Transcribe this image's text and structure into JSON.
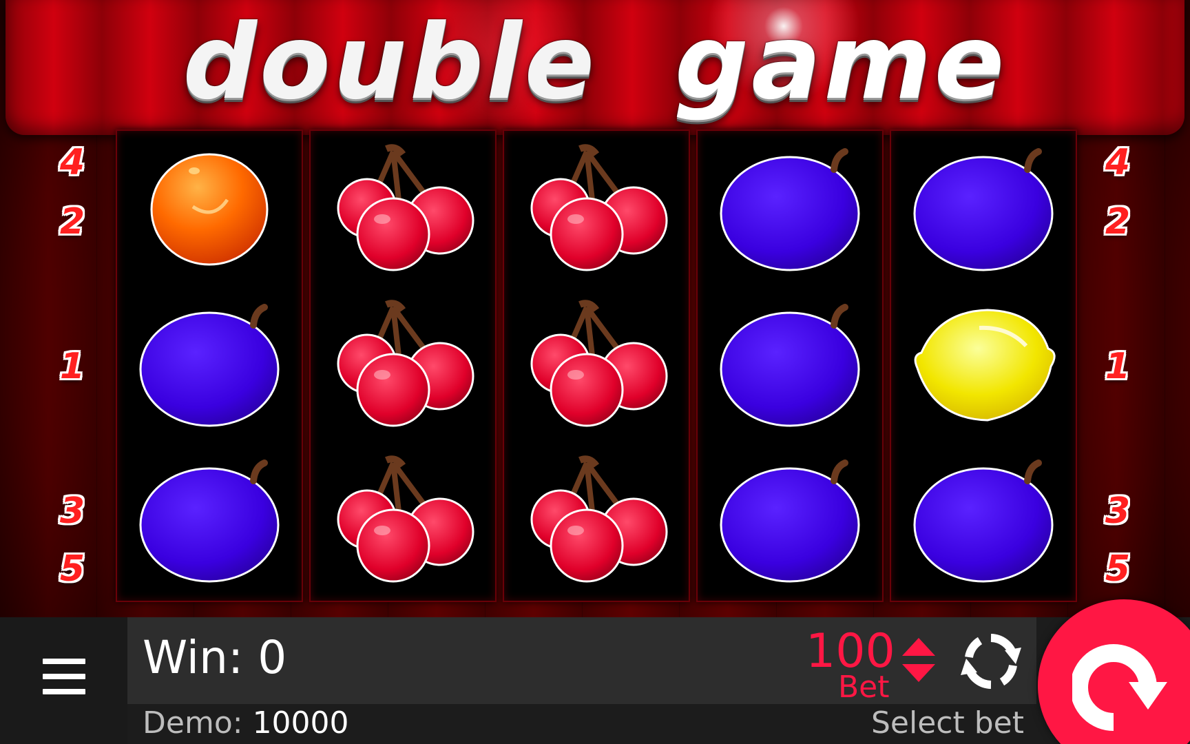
{
  "title": {
    "word1": "double",
    "word2": "game"
  },
  "lines_left": [
    "4",
    "2",
    "1",
    "3",
    "5"
  ],
  "lines_right": [
    "4",
    "2",
    "1",
    "3",
    "5"
  ],
  "reels": [
    [
      "orange",
      "plum",
      "plum"
    ],
    [
      "cherry",
      "cherry",
      "cherry"
    ],
    [
      "cherry",
      "cherry",
      "cherry"
    ],
    [
      "plum",
      "plum",
      "plum"
    ],
    [
      "plum",
      "lemon",
      "plum"
    ]
  ],
  "bottom_bar": {
    "menu_icon": "hamburger-menu-icon",
    "win_label": "Win:",
    "win_value": "0",
    "bet_value": "100",
    "bet_label": "Bet",
    "autoplay_icon": "autoplay-refresh-icon",
    "demo_label": "Demo:",
    "demo_value": "10000",
    "select_bet_label": "Select bet",
    "spin_icon": "spin-arrow-icon"
  },
  "colors": {
    "accent": "#ff1744",
    "bar_bg": "#2d2d2d",
    "background_red": "#b3000c"
  }
}
